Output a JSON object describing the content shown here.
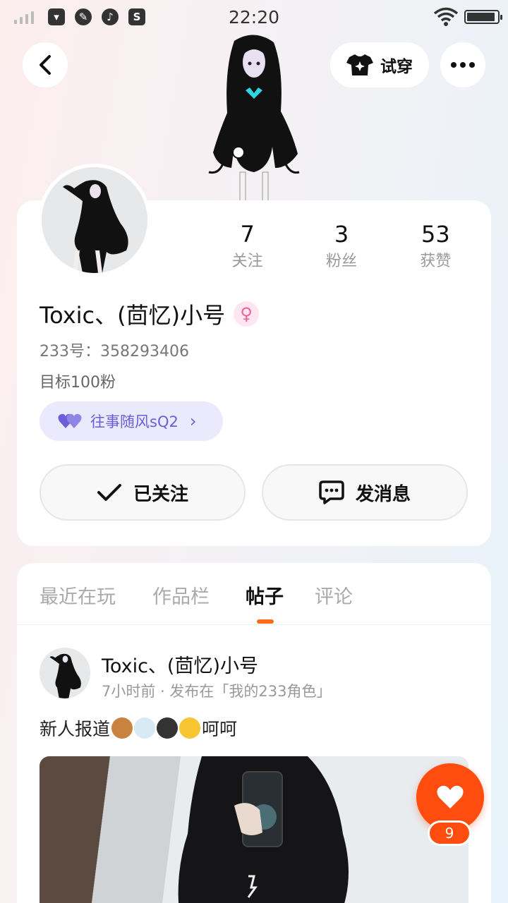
{
  "status_bar": {
    "time": "22:20",
    "battery_level": 0.92,
    "icons": [
      "signal-icon",
      "shopping-bag-icon",
      "palette-icon",
      "music-icon",
      "s-app-icon",
      "wifi-icon",
      "battery-icon"
    ]
  },
  "header": {
    "try_on_label": "试穿"
  },
  "profile": {
    "stats": [
      {
        "value": "7",
        "label": "关注"
      },
      {
        "value": "3",
        "label": "粉丝"
      },
      {
        "value": "53",
        "label": "获赞"
      }
    ],
    "username": "Toxic、(茴忆)小号",
    "gender_symbol": "♀",
    "id_text": "233号：358293406",
    "bio": "目标100粉",
    "relation_chip": "往事随风sQ2",
    "follow_label": "已关注",
    "message_label": "发消息"
  },
  "tabs": [
    "最近在玩",
    "作品栏",
    "帖子",
    "评论"
  ],
  "active_tab": "帖子",
  "post": {
    "author": "Toxic、(茴忆)小号",
    "meta": "7小时前 · 发布在「我的233角色」",
    "text_start": "新人报道",
    "text_end": "呵呵",
    "like_count": "9"
  },
  "colors": {
    "accent_orange": "#ff4d0f",
    "chip_purple": "#6b5ed6",
    "chip_bg": "#ebe9fc",
    "gender_pink": "#f0609a"
  }
}
